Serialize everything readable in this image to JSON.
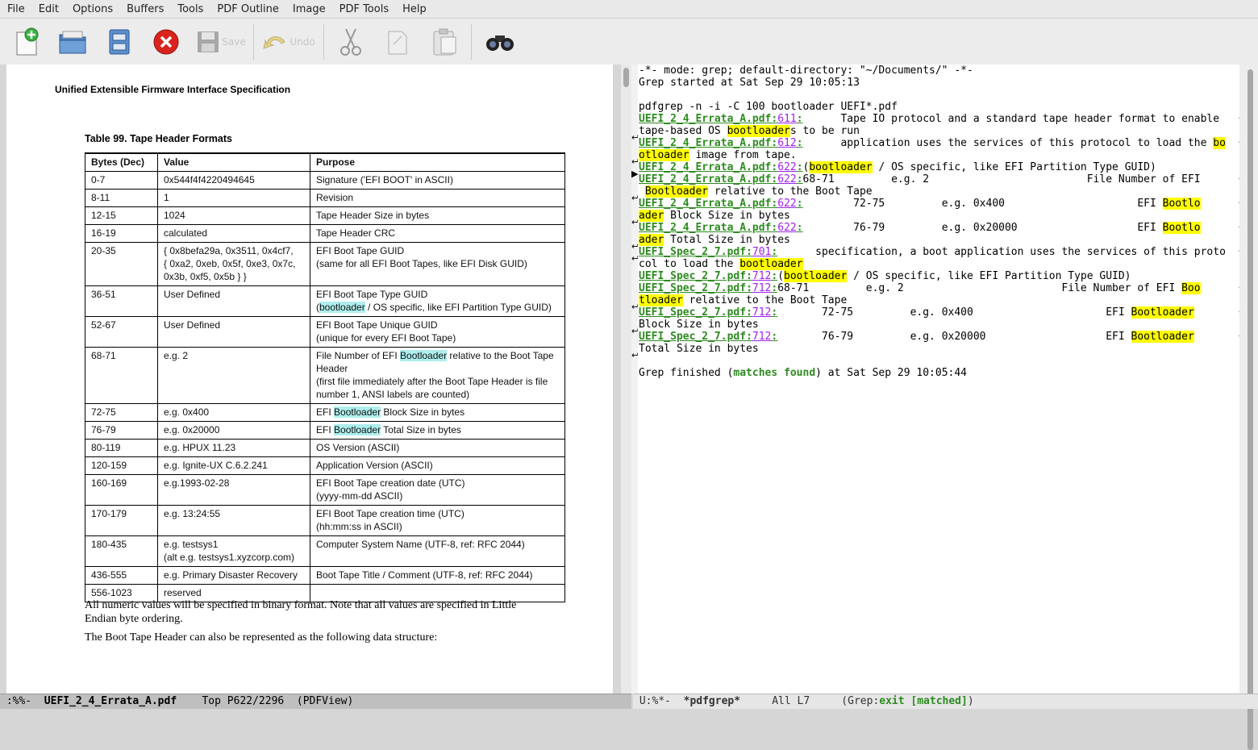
{
  "menubar": [
    "File",
    "Edit",
    "Options",
    "Buffers",
    "Tools",
    "PDF Outline",
    "Image",
    "PDF Tools",
    "Help"
  ],
  "toolbar": {
    "save_label": "Save",
    "undo_label": "Undo"
  },
  "pdf": {
    "header": "Unified Extensible Firmware Interface Specification",
    "caption": "Table 99. Tape Header Formats",
    "columns": [
      "Bytes (Dec)",
      "Value",
      "Purpose"
    ],
    "rows": [
      {
        "bytes": "0-7",
        "value": "0x544f4f4220494645",
        "purpose": "Signature ('EFI BOOT' in ASCII)"
      },
      {
        "bytes": "8-11",
        "value": "1",
        "purpose": "Revision"
      },
      {
        "bytes": "12-15",
        "value": "1024",
        "purpose": "Tape Header Size in bytes"
      },
      {
        "bytes": "16-19",
        "value": "calculated",
        "purpose": "Tape Header CRC"
      },
      {
        "bytes": "20-35",
        "value": "{ 0x8befa29a, 0x3511, 0x4cf7,",
        "value2": "{ 0xa2, 0xeb, 0x5f, 0xe3, 0x7c,",
        "value3": "0x3b, 0xf5, 0x5b } }",
        "purpose": "EFI Boot Tape GUID",
        "purpose2": "(same for all EFI Boot Tapes, like EFI Disk GUID)"
      },
      {
        "bytes": "36-51",
        "value": "User Defined",
        "purpose": "EFI Boot Tape Type GUID",
        "purpose2_pre": "(",
        "purpose2_hl": "bootloader",
        "purpose2_post": " / OS specific, like EFI Partition Type GUID)"
      },
      {
        "bytes": "52-67",
        "value": "User Defined",
        "purpose": "EFI Boot Tape Unique GUID",
        "purpose2": "(unique for every EFI Boot Tape)"
      },
      {
        "bytes": "68-71",
        "value": "e.g. 2",
        "purpose_pre": "File Number of EFI ",
        "purpose_hl": "Bootloader",
        "purpose_post": " relative to the Boot Tape",
        "purpose_l2": "Header",
        "purpose_l3": "(first file immediately after the Boot Tape Header is file",
        "purpose_l4": "number 1, ANSI labels are counted)"
      },
      {
        "bytes": "72-75",
        "value": "e.g. 0x400",
        "purpose_pre": "EFI ",
        "purpose_hl": "Bootloader",
        "purpose_post": " Block Size in bytes"
      },
      {
        "bytes": "76-79",
        "value": "e.g. 0x20000",
        "purpose_pre": "EFI ",
        "purpose_hl": "Bootloader",
        "purpose_post": " Total Size in bytes"
      },
      {
        "bytes": "80-119",
        "value": "e.g. HPUX 11.23",
        "purpose": "OS Version (ASCII)"
      },
      {
        "bytes": "120-159",
        "value": "e.g. Ignite-UX C.6.2.241",
        "purpose": "Application Version (ASCII)"
      },
      {
        "bytes": "160-169",
        "value": "e.g.1993-02-28",
        "purpose": "EFI Boot Tape creation date (UTC)",
        "purpose2": "(yyyy-mm-dd ASCII)"
      },
      {
        "bytes": "170-179",
        "value": "e.g. 13:24:55",
        "purpose": "EFI Boot Tape creation time (UTC)",
        "purpose2": "(hh:mm:ss in ASCII)"
      },
      {
        "bytes": "180-435",
        "value": "e.g. testsys1",
        "value2": "(alt e.g. testsys1.xyzcorp.com)",
        "purpose": "Computer System Name (UTF-8, ref: RFC 2044)"
      },
      {
        "bytes": "436-555",
        "value": "e.g. Primary Disaster Recovery",
        "purpose": "Boot Tape Title / Comment (UTF-8, ref: RFC 2044)"
      },
      {
        "bytes": "556-1023",
        "value": "reserved",
        "purpose": ""
      }
    ],
    "para1_line1": "All numeric values will be specified in binary format.  Note that all values are specified in Little",
    "para1_line2": "Endian byte ordering.",
    "para2": "The Boot Tape Header can also be represented as the following data structure:"
  },
  "grep": {
    "l1": "-*- mode: grep; default-directory: \"~/Documents/\" -*-",
    "l2": "Grep started at Sat Sep 29 10:05:13",
    "l4": "pdfgrep -n -i -C 100 bootloader UEFI*.pdf",
    "f1": "UEFI_2_4_Errata_A.pdf",
    "f2": "UEFI_Spec_2_7.pdf",
    "n611": "611",
    "n612": "612",
    "n622": "622",
    "n701": "701",
    "n712": "712",
    "bl": "bootloader",
    "Bl": "Bootloader",
    "m1a": "      Tape IO protocol and a standard tape header format to enable ",
    "m1b": "tape-based OS ",
    "m1c": "s to be run",
    "m2a": "      application uses the services of this protocol to load the ",
    "m2hl": "bo",
    "m2b_hl": "otloader",
    "m2b": " image from tape.",
    "m3a": "(",
    "m3b": " / OS specific, like EFI Partition Type GUID)",
    "m4a": "68-71         e.g. 2                         File Number of EFI",
    "m4b": " relative to the Boot Tape",
    "m5a": "        72-75         e.g. 0x400                     EFI ",
    "m5hl": "Bootlo",
    "m5b_hl": "ader",
    "m5b": " Block Size in bytes",
    "m6a": "        76-79         e.g. 0x20000                   EFI ",
    "m6b": " Total Size in bytes",
    "m7a": "      specification, a boot application uses the services of this proto",
    "m7b": "col to load the ",
    "m8b": " / OS specific, like EFI Partition Type GUID)",
    "m9a": "68-71         e.g. 2                         File Number of EFI ",
    "m9hl": "Boo",
    "m9b_hl": "tloader",
    "m9b": " relative to the Boot Tape",
    "m10a": "       72-75         e.g. 0x400                     EFI ",
    "m10b": "Block Size in bytes",
    "m11a": "       76-79         e.g. 0x20000                   EFI ",
    "m11b": "Total Size in bytes",
    "fin_a": "Grep finished (",
    "fin_m": "matches found",
    "fin_b": ") at Sat Sep 29 10:05:44"
  },
  "modeline_left": {
    "status": " :%%-  ",
    "buffer": "UEFI_2_4_Errata_A.pdf",
    "pos": "    Top P622/2296  (PDFView)"
  },
  "modeline_right": {
    "status": " U:%*-  ",
    "buffer": "*pdfgrep*",
    "pos": "     All L7     (Grep:",
    "exit": "exit [matched]",
    "close": ")"
  }
}
